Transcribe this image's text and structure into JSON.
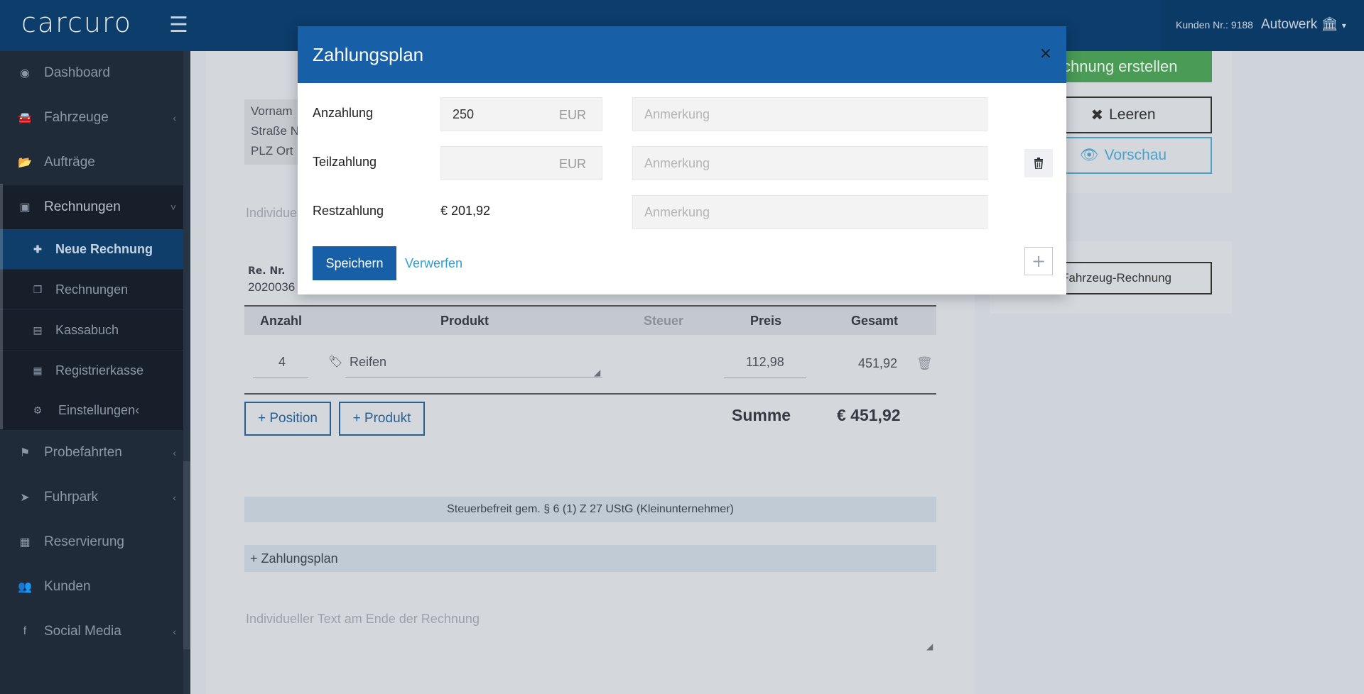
{
  "topbar": {
    "logo": "carcuro",
    "customer_nr": "Kunden Nr.: 9188",
    "company": "Autowerk"
  },
  "sidebar": {
    "items": [
      {
        "label": "Dashboard",
        "icon": "dashboard-icon"
      },
      {
        "label": "Fahrzeuge",
        "icon": "car-icon"
      },
      {
        "label": "Aufträge",
        "icon": "folder-icon"
      },
      {
        "label": "Rechnungen",
        "icon": "money-icon"
      },
      {
        "label": "Probefahrten",
        "icon": "flag-icon"
      },
      {
        "label": "Fuhrpark",
        "icon": "location-arrow-icon"
      },
      {
        "label": "Reservierung",
        "icon": "calendar-icon"
      },
      {
        "label": "Kunden",
        "icon": "users-icon"
      },
      {
        "label": "Social Media",
        "icon": "facebook-icon"
      }
    ],
    "sub_items": [
      {
        "label": "Neue Rechnung",
        "icon": "plus-icon"
      },
      {
        "label": "Rechnungen",
        "icon": "copy-icon"
      },
      {
        "label": "Kassabuch",
        "icon": "book-icon"
      },
      {
        "label": "Registrierkasse",
        "icon": "calculator-icon"
      },
      {
        "label": "Einstellungen",
        "icon": "gear-icon"
      }
    ]
  },
  "invoice": {
    "address": [
      "Vornam",
      "Straße N",
      "PLZ Ort"
    ],
    "indiv_text_top": "Individue",
    "re_nr_label": "Re. Nr.",
    "re_nr_value": "2020036",
    "columns": [
      "Anzahl",
      "Produkt",
      "Steuer",
      "Preis",
      "Gesamt"
    ],
    "row": {
      "anzahl": "4",
      "produkt": "Reifen",
      "preis": "112,98",
      "gesamt": "451,92"
    },
    "add_position": "+ Position",
    "add_produkt": "+ Produkt",
    "summe_label": "Summe",
    "summe_value": "€ 451,92",
    "tax_note": "Steuerbefreit gem. § 6 (1) Z 27 UStG (Kleinunternehmer)",
    "zahlungsplan_link": "+ Zahlungsplan",
    "indiv_text_bottom": "Individueller Text am Ende der Rechnung"
  },
  "right_panel": {
    "create_label": "chnung erstellen",
    "leeren_label": "Leeren",
    "vorschau_label": "Vorschau",
    "fahrzeug_label": "Fahrzeug-Rechnung"
  },
  "modal": {
    "title": "Zahlungsplan",
    "close_symbol": "×",
    "rows": [
      {
        "label": "Anzahlung",
        "value": "250",
        "unit": "EUR",
        "note_placeholder": "Anmerkung"
      },
      {
        "label": "Teilzahlung",
        "value": "",
        "unit": "EUR",
        "note_placeholder": "Anmerkung"
      },
      {
        "label": "Restzahlung",
        "amount": "€ 201,92",
        "note_placeholder": "Anmerkung"
      }
    ],
    "save_label": "Speichern",
    "discard_label": "Verwerfen",
    "add_symbol": "+"
  },
  "colors": {
    "primary": "#1760a8",
    "link": "#2d9fd9",
    "sidebar_bg": "#1f2b39",
    "success": "#4a9b56"
  }
}
